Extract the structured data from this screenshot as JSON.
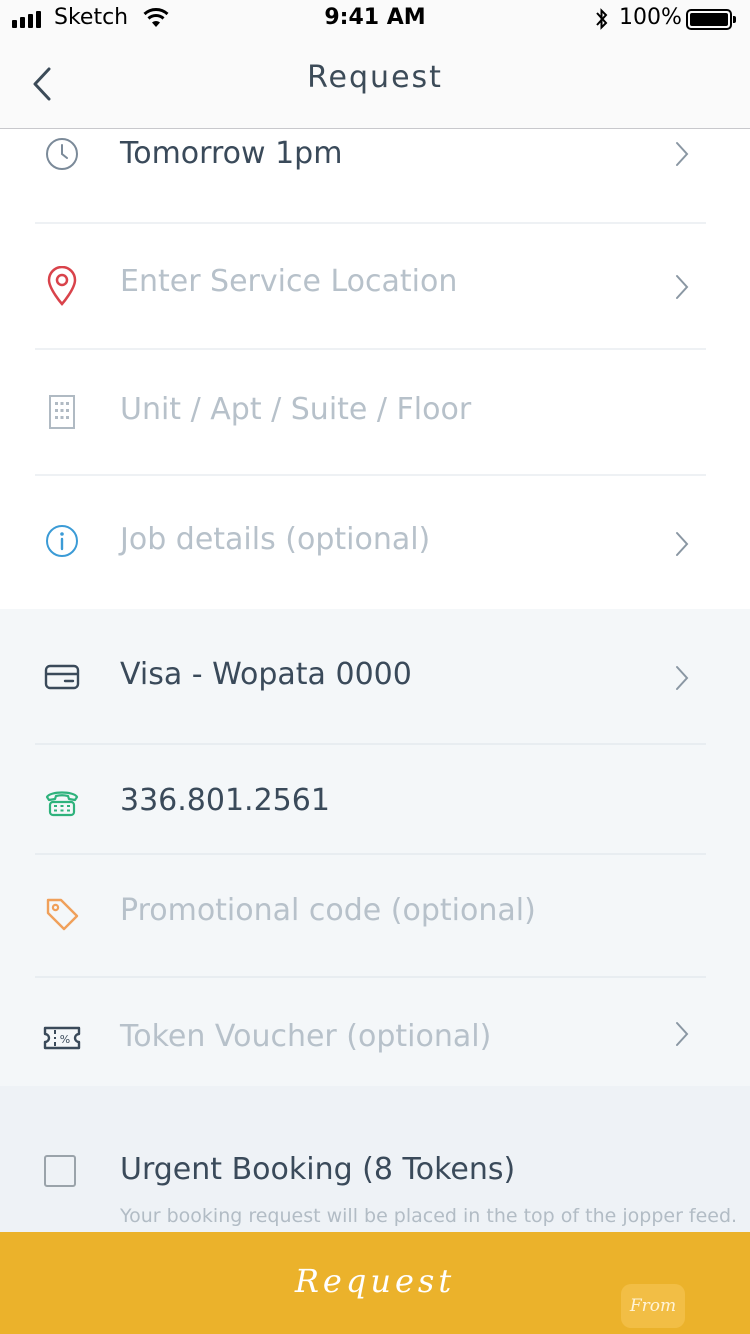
{
  "status_bar": {
    "carrier": "Sketch",
    "time": "9:41 AM",
    "battery": "100%",
    "battery_level": 1.0
  },
  "nav": {
    "title": "Request",
    "back_icon": "chevron-left-icon"
  },
  "rows": [
    {
      "icon": "clock-icon",
      "text": "Tomorrow 1pm",
      "state": "value",
      "chevron": true
    },
    {
      "icon": "map-pin-icon",
      "text": "Enter Service Location",
      "state": "placeholder",
      "chevron": true
    },
    {
      "icon": "building-icon",
      "text": "Unit / Apt / Suite / Floor",
      "state": "placeholder",
      "chevron": false
    },
    {
      "icon": "info-icon",
      "text": "Job details (optional)",
      "state": "placeholder",
      "chevron": true
    },
    {
      "icon": "credit-card-icon",
      "text": "Visa - Wopata 0000",
      "state": "value",
      "chevron": true
    },
    {
      "icon": "telephone-icon",
      "text": "336.801.2561",
      "state": "value",
      "chevron": false
    },
    {
      "icon": "tag-icon",
      "text": "Promotional code (optional)",
      "state": "placeholder",
      "chevron": false
    },
    {
      "icon": "ticket-icon",
      "text": "Token Voucher (optional)",
      "state": "placeholder",
      "chevron": true
    }
  ],
  "urgent": {
    "title": "Urgent Booking (8 Tokens)",
    "description": "Your booking request will be placed in the top of the jopper feed.",
    "checked": false
  },
  "bottom_button": {
    "label": "Request",
    "badge": "From"
  },
  "colors": {
    "accent": "#EBB22B",
    "pin_red": "#D9434B",
    "info_blue": "#3B9BD6",
    "phone_green": "#2EB27C",
    "tag_orange": "#F0A05A",
    "text_dark": "#3A4A5A",
    "placeholder": "#B7C1CA"
  }
}
